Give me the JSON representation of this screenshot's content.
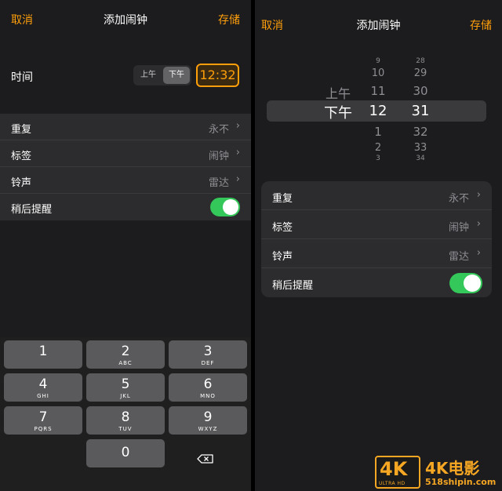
{
  "left": {
    "nav": {
      "cancel": "取消",
      "title": "添加闹钟",
      "save": "存储"
    },
    "time_label": "时间",
    "am": "上午",
    "pm": "下午",
    "time_value": "12:32",
    "settings": [
      {
        "label": "重复",
        "value": "永不"
      },
      {
        "label": "标签",
        "value": "闹钟"
      },
      {
        "label": "铃声",
        "value": "雷达"
      },
      {
        "label": "稍后提醒",
        "toggle": true
      }
    ],
    "keypad": [
      {
        "digit": "1",
        "letters": ""
      },
      {
        "digit": "2",
        "letters": "ABC"
      },
      {
        "digit": "3",
        "letters": "DEF"
      },
      {
        "digit": "4",
        "letters": "GHI"
      },
      {
        "digit": "5",
        "letters": "JKL"
      },
      {
        "digit": "6",
        "letters": "MNO"
      },
      {
        "digit": "7",
        "letters": "PQRS"
      },
      {
        "digit": "8",
        "letters": "TUV"
      },
      {
        "digit": "9",
        "letters": "WXYZ"
      },
      {
        "digit": "0",
        "letters": ""
      }
    ]
  },
  "right": {
    "nav": {
      "cancel": "取消",
      "title": "添加闹钟",
      "save": "存储"
    },
    "picker": {
      "ampm": [
        "上午",
        "下午"
      ],
      "hours": [
        "9",
        "10",
        "11",
        "12",
        "1",
        "2",
        "3"
      ],
      "minutes": [
        "28",
        "29",
        "30",
        "31",
        "32",
        "33",
        "34"
      ],
      "selected": {
        "ampm": "下午",
        "hour": "12",
        "minute": "31"
      }
    },
    "settings": [
      {
        "label": "重复",
        "value": "永不"
      },
      {
        "label": "标签",
        "value": "闹钟"
      },
      {
        "label": "铃声",
        "value": "雷达"
      },
      {
        "label": "稍后提醒",
        "toggle": true
      }
    ]
  },
  "watermark": {
    "badge": "4K",
    "badge_sub": "ULTRA HD",
    "text": "4K电影",
    "url": "518shipin.com"
  },
  "colors": {
    "accent": "#ff9f0a",
    "toggle_on": "#34c759",
    "background": "#1c1c1e",
    "cell": "#2c2c2e"
  },
  "icons": {
    "chevron": "chevron-right-icon",
    "delete": "delete-left-icon"
  }
}
